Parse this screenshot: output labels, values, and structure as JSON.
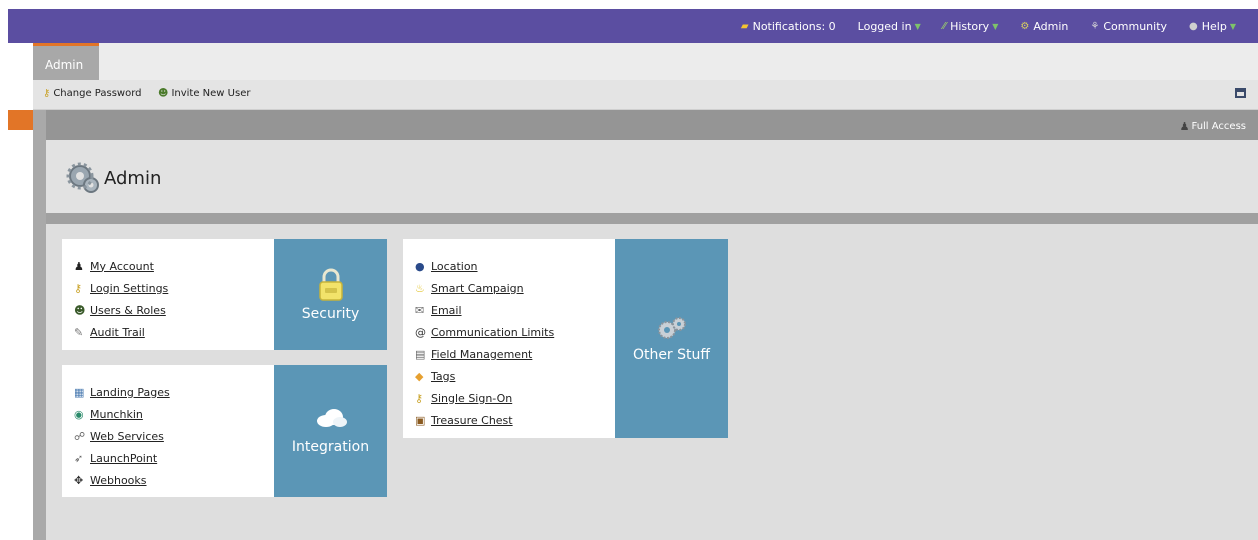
{
  "topnav": {
    "notifications": "Notifications: 0",
    "logged_in": "Logged in",
    "history": "History",
    "admin": "Admin",
    "community": "Community",
    "help": "Help"
  },
  "tabs": {
    "admin": "Admin"
  },
  "toolbar": {
    "change_password": "Change Password",
    "invite_user": "Invite New User"
  },
  "banner": {
    "full_access": "Full Access"
  },
  "page": {
    "title": "Admin"
  },
  "sections": {
    "security": {
      "title": "Security",
      "links": [
        "My Account",
        "Login Settings",
        "Users & Roles",
        "Audit Trail"
      ]
    },
    "integration": {
      "title": "Integration",
      "links": [
        "Landing Pages",
        "Munchkin",
        "Web Services",
        "LaunchPoint",
        "Webhooks"
      ]
    },
    "other": {
      "title": "Other Stuff",
      "links": [
        "Location",
        "Smart Campaign",
        "Email",
        "Communication Limits",
        "Field Management",
        "Tags",
        "Single Sign-On",
        "Treasure Chest"
      ]
    }
  },
  "colors": {
    "topbar": "#5b4ea1",
    "accent": "#e27527",
    "tile": "#5b96b6"
  }
}
